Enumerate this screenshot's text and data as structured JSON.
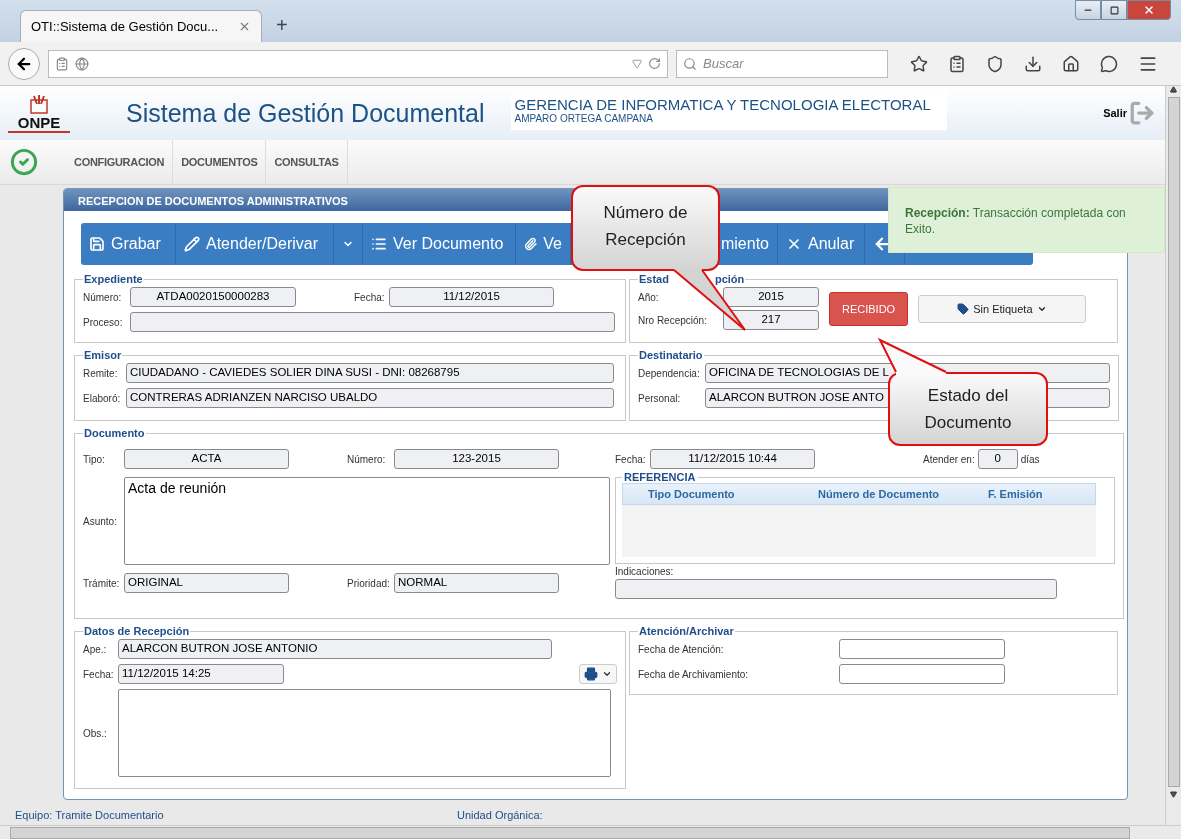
{
  "browser": {
    "tab_title": "OTI::Sistema de Gestión Docu...",
    "new_tab": "+",
    "search_placeholder": "Buscar"
  },
  "header": {
    "logo": "ONPE",
    "title": "Sistema de Gestión Documental",
    "organization": "GERENCIA DE INFORMATICA Y TECNOLOGIA ELECTORAL",
    "user": "AMPARO ORTEGA CAMPANA",
    "logout": "Salir"
  },
  "menu": [
    {
      "label": "CONFIGURACION"
    },
    {
      "label": "DOCUMENTOS"
    },
    {
      "label": "CONSULTAS"
    }
  ],
  "panel": {
    "title": "RECEPCION DE DOCUMENTOS ADMINISTRATIVOS",
    "toolbar": [
      {
        "kind": "button",
        "label": "Grabar"
      },
      {
        "kind": "button",
        "label": "Atender/Derivar"
      },
      {
        "kind": "caret"
      },
      {
        "kind": "button",
        "label": "Ver Documento"
      },
      {
        "kind": "button",
        "label": "Ve"
      },
      {
        "kind": "button",
        "label": "miento"
      },
      {
        "kind": "button",
        "label": "Anular"
      },
      {
        "kind": "icon"
      }
    ],
    "expediente": {
      "legend": "Expediente",
      "numero": {
        "label": "Número:",
        "value": "ATDA0020150000283"
      },
      "fecha": {
        "label": "Fecha:",
        "value": "11/12/2015"
      },
      "proceso": {
        "label": "Proceso:"
      }
    },
    "estado": {
      "legend": [
        "Estad",
        "pción"
      ],
      "anio": {
        "label": "Año:",
        "value": "2015"
      },
      "nro": {
        "label": "Nro Recepción:",
        "value": "217"
      },
      "status": "RECIBIDO",
      "tag": "Sin Etiqueta"
    },
    "emisor": {
      "legend": "Emisor",
      "fields": [
        {
          "label": "Remite:",
          "value": "CIUDADANO - CAVIEDES SOLIER DINA SUSI - DNI: 08268795"
        },
        {
          "label": "Elaboró:",
          "value": "CONTRERAS ADRIANZEN NARCISO UBALDO"
        }
      ]
    },
    "destinatario": {
      "legend": "Destinatario",
      "fields": [
        {
          "label": "Dependencia:",
          "value": "OFICINA DE TECNOLOGIAS DE L"
        },
        {
          "label": "Personal:",
          "value": "ALARCON BUTRON JOSE ANTO"
        }
      ]
    },
    "documento": {
      "legend": "Documento",
      "tipo": {
        "label": "Tipo:",
        "value": "ACTA"
      },
      "numero": {
        "label": "Número:",
        "value": "123-2015"
      },
      "fecha": {
        "label": "Fecha:",
        "value": "11/12/2015 10:44"
      },
      "atender": {
        "label": "Atender en:",
        "value": "0",
        "unit": "días"
      },
      "asunto": {
        "label": "Asunto:",
        "value": "Acta de reunión"
      },
      "tramite": {
        "label": "Trámite:",
        "value": "ORIGINAL"
      },
      "prioridad": {
        "label": "Prioridad:",
        "value": "NORMAL"
      },
      "referencia": {
        "title": "REFERENCIA",
        "columns": [
          "Tipo Documento",
          "Número de Documento",
          "F. Emisión"
        ]
      },
      "indicaciones": {
        "label": "Indicaciones:"
      }
    },
    "recepcion": {
      "legend": "Datos de Recepción",
      "ape": {
        "label": "Ape.:",
        "value": "ALARCON BUTRON JOSE ANTONIO"
      },
      "fecha": {
        "label": "Fecha:",
        "value": "11/12/2015 14:25"
      },
      "obs": {
        "label": "Obs.:"
      }
    },
    "atencion": {
      "legend": "Atención/Archivar",
      "fields": [
        {
          "label": "Fecha de Atención:"
        },
        {
          "label": "Fecha de Archivamiento:"
        }
      ]
    }
  },
  "status_bar": [
    "Equipo: Tramite Documentario",
    "Unidad Orgánica:"
  ],
  "toast": "**Recepción:** Transacción completada con Exito.",
  "callouts": [
    "Número de Recepción",
    "Estado del Documento"
  ]
}
